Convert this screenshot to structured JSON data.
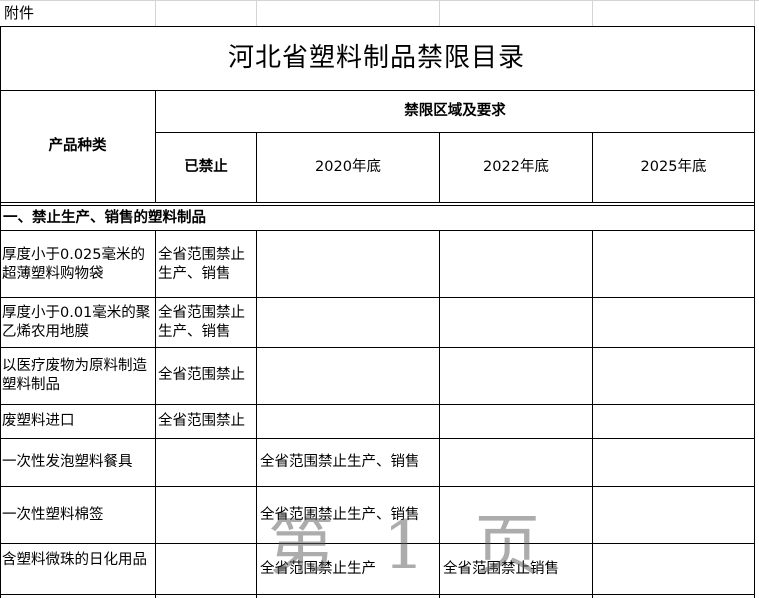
{
  "header_note": "附件",
  "title": "河北省塑料制品禁限目录",
  "columns": {
    "product_type": "产品种类",
    "restriction_scope": "禁限区域及要求",
    "banned": "已禁止",
    "y2020": "2020年底",
    "y2022": "2022年底",
    "y2025": "2025年底"
  },
  "section1": "一、禁止生产、销售的塑料制品",
  "rows": [
    {
      "product": "厚度小于0.025毫米的超薄塑料购物袋",
      "banned": "全省范围禁止生产、销售",
      "y2020": "",
      "y2022": "",
      "y2025": ""
    },
    {
      "product": "厚度小于0.01毫米的聚乙烯农用地膜",
      "banned": "全省范围禁止生产、销售",
      "y2020": "",
      "y2022": "",
      "y2025": ""
    },
    {
      "product": "以医疗废物为原料制造塑料制品",
      "banned": "全省范围禁止",
      "y2020": "",
      "y2022": "",
      "y2025": ""
    },
    {
      "product": "废塑料进口",
      "banned": "全省范围禁止",
      "y2020": "",
      "y2022": "",
      "y2025": ""
    },
    {
      "product": "一次性发泡塑料餐具",
      "banned": "",
      "y2020": "全省范围禁止生产、销售",
      "y2022": "",
      "y2025": ""
    },
    {
      "product": "一次性塑料棉签",
      "banned": "",
      "y2020": "全省范围禁止生产、销售",
      "y2022": "",
      "y2025": ""
    },
    {
      "product": "含塑料微珠的日化用品",
      "banned": "",
      "y2020": "全省范围禁止生产",
      "y2022": "全省范围禁止销售",
      "y2025": ""
    }
  ],
  "watermark": "第 1 页"
}
